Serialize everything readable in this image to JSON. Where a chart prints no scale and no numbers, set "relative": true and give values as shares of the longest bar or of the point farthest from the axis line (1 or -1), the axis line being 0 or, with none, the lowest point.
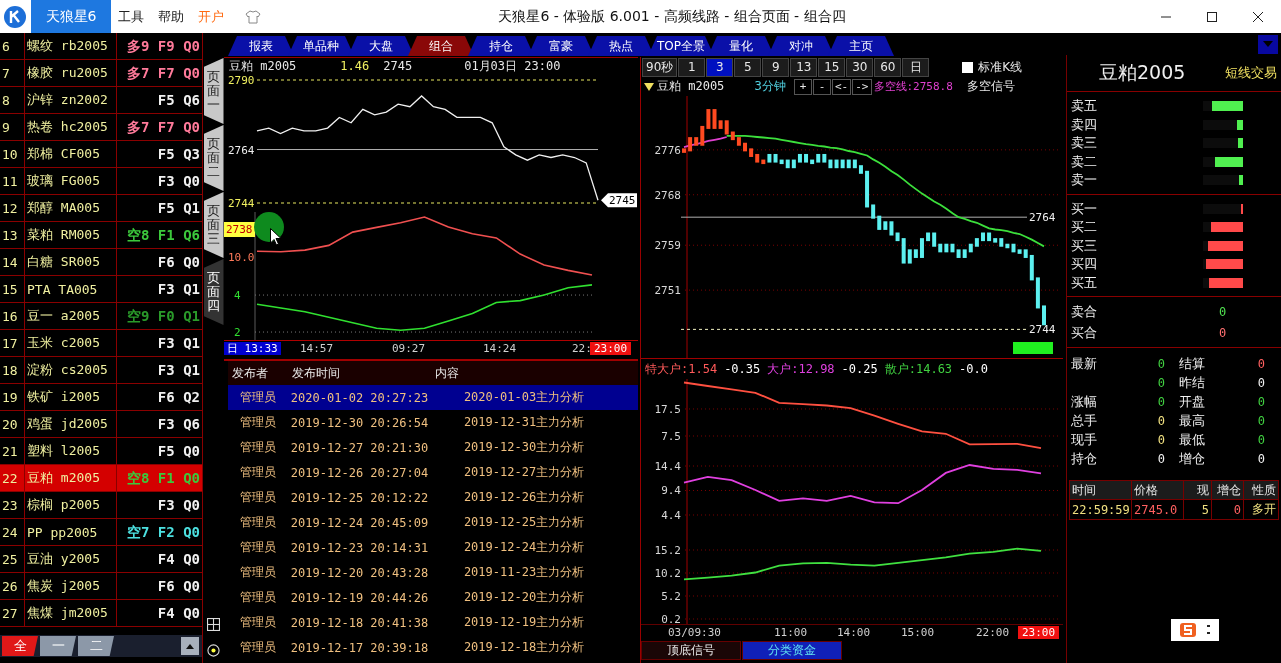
{
  "title_bar": {
    "app_tab": "天狼星6",
    "menu": [
      {
        "label": "工具",
        "kind": "plain"
      },
      {
        "label": "帮助",
        "kind": "plain"
      },
      {
        "label": "开户",
        "kind": "accent"
      }
    ],
    "title": "天狼星6 - 体验版 6.001 - 高频线路 - 组合页面 - 组合四"
  },
  "nav_tabs": [
    {
      "label": "报表",
      "selected": false
    },
    {
      "label": "单品种",
      "selected": false
    },
    {
      "label": "大盘",
      "selected": false
    },
    {
      "label": "组合",
      "selected": true
    },
    {
      "label": "持仓",
      "selected": false
    },
    {
      "label": "富豪",
      "selected": false
    },
    {
      "label": "热点",
      "selected": false
    },
    {
      "label": "TOP全景",
      "selected": false
    },
    {
      "label": "量化",
      "selected": false
    },
    {
      "label": "对冲",
      "selected": false
    },
    {
      "label": "主页",
      "selected": false
    }
  ],
  "watchlist": {
    "rows": [
      {
        "index": "6",
        "name": "螺纹 rb2005",
        "signal": "多9 F9 Q0",
        "color": "#ff7a9a",
        "selected": false
      },
      {
        "index": "7",
        "name": "橡胶 ru2005",
        "signal": "多7 F7 Q0",
        "color": "#ff7a9a",
        "selected": false
      },
      {
        "index": "8",
        "name": "沪锌 zn2002",
        "signal": "F5 Q6",
        "color": "#f0f0f0",
        "selected": false
      },
      {
        "index": "9",
        "name": "热卷 hc2005",
        "signal": "多7 F7 Q0",
        "color": "#ff7a9a",
        "selected": false
      },
      {
        "index": "10",
        "name": "郑棉 CF005",
        "signal": "F5 Q3",
        "color": "#f0f0f0",
        "selected": false
      },
      {
        "index": "11",
        "name": "玻璃 FG005",
        "signal": "F3 Q0",
        "color": "#f0f0f0",
        "selected": false
      },
      {
        "index": "12",
        "name": "郑醇 MA005",
        "signal": "F5 Q1",
        "color": "#f0f0f0",
        "selected": false
      },
      {
        "index": "13",
        "name": "菜粕 RM005",
        "signal": "空8 F1 Q6",
        "color": "#3cc83c",
        "selected": false
      },
      {
        "index": "14",
        "name": "白糖 SR005",
        "signal": "F6 Q0",
        "color": "#f0f0f0",
        "selected": false
      },
      {
        "index": "15",
        "name": "PTA TA005",
        "signal": "F3 Q1",
        "color": "#f0f0f0",
        "selected": false
      },
      {
        "index": "16",
        "name": "豆一 a2005",
        "signal": "空9 F0 Q1",
        "color": "#2a9a2a",
        "selected": false
      },
      {
        "index": "17",
        "name": "玉米 c2005",
        "signal": "F3 Q1",
        "color": "#f0f0f0",
        "selected": false
      },
      {
        "index": "18",
        "name": "淀粉 cs2005",
        "signal": "F3 Q1",
        "color": "#f0f0f0",
        "selected": false
      },
      {
        "index": "19",
        "name": "铁矿 i2005",
        "signal": "F6 Q2",
        "color": "#f0f0f0",
        "selected": false
      },
      {
        "index": "20",
        "name": "鸡蛋 jd2005",
        "signal": "F3 Q6",
        "color": "#f0f0f0",
        "selected": false
      },
      {
        "index": "21",
        "name": "塑料 l2005",
        "signal": "F5 Q0",
        "color": "#f0f0f0",
        "selected": false
      },
      {
        "index": "22",
        "name": "豆粕 m2005",
        "signal": "空8 F1 Q0",
        "color": "#3cc83c",
        "selected": true
      },
      {
        "index": "23",
        "name": "棕榈 p2005",
        "signal": "F3 Q0",
        "color": "#f0f0f0",
        "selected": false
      },
      {
        "index": "24",
        "name": "PP pp2005",
        "signal": "空7 F2 Q0",
        "color": "#4ce0e0",
        "selected": false
      },
      {
        "index": "25",
        "name": "豆油 y2005",
        "signal": "F4 Q0",
        "color": "#f0f0f0",
        "selected": false
      },
      {
        "index": "26",
        "name": "焦炭 j2005",
        "signal": "F6 Q0",
        "color": "#f0f0f0",
        "selected": false
      },
      {
        "index": "27",
        "name": "焦煤 jm2005",
        "signal": "F4 Q0",
        "color": "#f0f0f0",
        "selected": false
      }
    ],
    "tabs": [
      {
        "label": "全",
        "selected": true
      },
      {
        "label": "一",
        "selected": false
      },
      {
        "label": "二",
        "selected": false
      }
    ]
  },
  "page_tabs": [
    {
      "label": "页面一",
      "selected": false
    },
    {
      "label": "页面二",
      "selected": false
    },
    {
      "label": "页面三",
      "selected": false
    },
    {
      "label": "页面四",
      "selected": true
    }
  ],
  "intraday": {
    "instrument": "豆粕 m2005",
    "change": "1.46",
    "price": "2745",
    "datetime": "01月03日 23:00",
    "last_price_tag": "2745",
    "cursor_price": "2738",
    "price_chart": {
      "chart_data": {
        "type": "line",
        "ylim": [
          2744,
          2790
        ],
        "yticks": [
          2790,
          2744
        ],
        "series": [
          {
            "color": "#f0f0f0",
            "values": [
              2771,
              2772,
              2770,
              2772,
              2771,
              2771,
              2772,
              2776,
              2774,
              2779,
              2777,
              2778,
              2781,
              2780,
              2784,
              2780,
              2779,
              2776,
              2776,
              2776,
              2774,
              2765,
              2762,
              2760,
              2762,
              2761,
              2762,
              2761,
              2759,
              2745
            ]
          }
        ],
        "ref_lines": [
          {
            "axis": "y",
            "value": 2764,
            "label": "2764"
          }
        ]
      }
    },
    "indicator_charts": [
      {
        "chart_data": {
          "type": "line",
          "relative": true,
          "series": [
            {
              "color": "#f05050",
              "values": [
                0.41,
                0.4,
                0.43,
                0.51,
                0.74,
                0.82,
                0.9,
                1.0,
                0.83,
                0.71,
                0.64,
                0.36,
                0.17,
                0.08,
                0.0
              ]
            }
          ],
          "annotations": [
            "10.0"
          ]
        }
      },
      {
        "chart_data": {
          "type": "line",
          "ylim": [
            1.57,
            8.49
          ],
          "yticks": [
            4,
            2
          ],
          "grid": true,
          "series": [
            {
              "color": "#30e030",
              "values": [
                3.5,
                3.3,
                3.1,
                2.8,
                2.5,
                2.2,
                2.1,
                2.2,
                2.6,
                3.0,
                3.6,
                3.7,
                4.0,
                4.4,
                4.55
              ]
            }
          ]
        }
      }
    ],
    "time_axis": [
      {
        "text": "日 13:33",
        "kind": "start"
      },
      {
        "text": "14:57",
        "kind": "plain"
      },
      {
        "text": "09:27",
        "kind": "plain"
      },
      {
        "text": "14:24",
        "kind": "plain"
      },
      {
        "text": "22:",
        "kind": "plain"
      },
      {
        "text": "23:00",
        "kind": "end"
      }
    ]
  },
  "news": {
    "columns": [
      "发布者",
      "发布时间",
      "内容"
    ],
    "rows": [
      {
        "publisher": "管理员",
        "time": "2020-01-02 20:27:23",
        "content": "2020-01-03主力分析",
        "selected": true
      },
      {
        "publisher": "管理员",
        "time": "2019-12-30 20:26:54",
        "content": "2019-12-31主力分析",
        "selected": false
      },
      {
        "publisher": "管理员",
        "time": "2019-12-27 20:21:30",
        "content": "2019-12-30主力分析",
        "selected": false
      },
      {
        "publisher": "管理员",
        "time": "2019-12-26 20:27:04",
        "content": "2019-12-27主力分析",
        "selected": false
      },
      {
        "publisher": "管理员",
        "time": "2019-12-25 20:12:22",
        "content": "2019-12-26主力分析",
        "selected": false
      },
      {
        "publisher": "管理员",
        "time": "2019-12-24 20:45:09",
        "content": "2019-12-25主力分析",
        "selected": false
      },
      {
        "publisher": "管理员",
        "time": "2019-12-23 20:14:31",
        "content": "2019-12-24主力分析",
        "selected": false
      },
      {
        "publisher": "管理员",
        "time": "2019-12-20 20:43:28",
        "content": "2019-11-23主力分析",
        "selected": false
      },
      {
        "publisher": "管理员",
        "time": "2019-12-19 20:44:26",
        "content": "2019-12-20主力分析",
        "selected": false
      },
      {
        "publisher": "管理员",
        "time": "2019-12-18 20:41:38",
        "content": "2019-12-19主力分析",
        "selected": false
      },
      {
        "publisher": "管理员",
        "time": "2019-12-17 20:39:18",
        "content": "2019-12-18主力分析",
        "selected": false
      }
    ]
  },
  "kline": {
    "periods": [
      {
        "label": "90秒",
        "selected": false
      },
      {
        "label": "1",
        "selected": false
      },
      {
        "label": "3",
        "selected": true
      },
      {
        "label": "5",
        "selected": false
      },
      {
        "label": "9",
        "selected": false
      },
      {
        "label": "13",
        "selected": false
      },
      {
        "label": "15",
        "selected": false
      },
      {
        "label": "30",
        "selected": false
      },
      {
        "label": "60",
        "selected": false
      },
      {
        "label": "日",
        "selected": false
      }
    ],
    "standard_k": {
      "label": "标准K线",
      "checked": false
    },
    "instrument": "豆粕 m2005",
    "period_label": "3分钟",
    "controls": [
      "+",
      "-",
      "<-",
      "->"
    ],
    "ma_label": "多空线:2758.8",
    "signal_label": "多空信号",
    "chart_data": {
      "type": "line",
      "ylim": [
        2738.9,
        2785.6
      ],
      "yticks": [
        2776,
        2768,
        2759,
        2751
      ],
      "grid": true,
      "series": [
        {
          "color": "#3ce03c",
          "values": [
            null,
            null,
            null,
            null,
            null,
            null,
            null,
            2778.5,
            2778.5,
            2778.5,
            2778.5,
            2778.4,
            2778.3,
            2778.2,
            2778.1,
            2778,
            2777.8,
            2777.6,
            2777.4,
            2777.2,
            2777,
            2776.9,
            2776.7,
            2776.6,
            2776.4,
            2776.3,
            2776.1,
            2775.8,
            2775.6,
            2775.3,
            2775,
            2774.3,
            2773.7,
            2773,
            2772.2,
            2771.5,
            2770.7,
            2769.8,
            2769,
            2768.2,
            2767.5,
            2766.8,
            2766.2,
            2765.5,
            2764.7,
            2764,
            2763.7,
            2763.3,
            2763,
            2762.5,
            2762,
            2761.8,
            2761.7,
            2761.5,
            2761.2,
            2761,
            2760.5,
            2760,
            2759.4,
            2758.8
          ]
        },
        {
          "color": "#e040d0",
          "values": [
            2776.5,
            2776.8,
            2777,
            2777.3,
            2777.6,
            2777.8,
            2778,
            2778.3,
            null,
            null,
            null,
            null,
            null,
            null,
            null,
            null,
            null,
            null,
            null,
            null,
            null,
            null,
            null,
            null,
            null,
            null,
            null,
            null,
            null,
            null,
            null,
            null,
            null,
            null,
            null,
            null,
            null,
            null,
            null,
            null,
            null,
            null,
            null,
            null,
            null,
            null,
            null,
            null,
            null,
            null,
            null,
            null,
            null,
            null,
            null,
            null,
            null,
            null,
            null,
            null
          ]
        }
      ],
      "ref_lines": [
        {
          "axis": "y",
          "value": 2764,
          "label": "2764"
        },
        {
          "axis": "y",
          "value": 2744,
          "label": "2744"
        }
      ]
    },
    "flow_labels": [
      {
        "text": "特大户:1.54",
        "color": "#ff5a5a"
      },
      {
        "text": "-0.35",
        "color": "#ffffff"
      },
      {
        "text": "大户:12.98",
        "color": "#e040e0"
      },
      {
        "text": "-0.25",
        "color": "#ffffff"
      },
      {
        "text": "散户:14.63",
        "color": "#40d040"
      },
      {
        "text": "-0.0",
        "color": "#ffffff"
      }
    ],
    "flow_panels": [
      {
        "chart_data": {
          "type": "line",
          "ylim": [
            0.83,
            28.6
          ],
          "yticks": [
            17.5,
            7.5
          ],
          "grid": true,
          "series": [
            {
              "color": "#ff5040",
              "values": [
                27.3,
                26,
                24.8,
                23.5,
                19.8,
                19.3,
                18.8,
                17.8,
                15,
                12,
                9.2,
                8.3,
                4.4,
                4.5,
                4.6,
                3.0
              ]
            }
          ]
        }
      },
      {
        "chart_data": {
          "type": "line",
          "ylim": [
            2.56,
            16.85
          ],
          "yticks": [
            14.4,
            9.4,
            4.4
          ],
          "grid": true,
          "series": [
            {
              "color": "#e040e0",
              "values": [
                11.0,
                12.2,
                11.5,
                9.5,
                7.3,
                7.8,
                7.3,
                8.3,
                7.0,
                6.8,
                9.5,
                13.0,
                14.6,
                13.8,
                13.6,
                12.9
              ]
            }
          ]
        }
      },
      {
        "chart_data": {
          "type": "line",
          "ylim": [
            -0.89,
            20.85
          ],
          "yticks": [
            15.2,
            10.2,
            5.2,
            0.2
          ],
          "grid": true,
          "series": [
            {
              "color": "#40e040",
              "values": [
                8.8,
                9.2,
                9.6,
                10.3,
                11.8,
                12.3,
                12.4,
                12.0,
                11.8,
                12.4,
                13.0,
                13.6,
                14.4,
                14.8,
                15.5,
                15.0
              ]
            }
          ]
        }
      }
    ],
    "time_axis": [
      {
        "text": "03/09:30",
        "kind": "plain"
      },
      {
        "text": "11:00",
        "kind": "plain"
      },
      {
        "text": "14:00",
        "kind": "plain"
      },
      {
        "text": "15:00",
        "kind": "plain"
      },
      {
        "text": "22:00",
        "kind": "plain"
      },
      {
        "text": "23:00",
        "kind": "end"
      }
    ],
    "bottom_tabs": [
      {
        "label": "顶底信号",
        "selected": false
      },
      {
        "label": "分类资金",
        "selected": true
      }
    ]
  },
  "quote_panel": {
    "title": "豆粕2005",
    "mode": "短线交易",
    "asks": [
      {
        "label": "卖五",
        "level": 0.78
      },
      {
        "label": "卖四",
        "level": 0.15
      },
      {
        "label": "卖三",
        "level": 0.13
      },
      {
        "label": "卖二",
        "level": 0.7
      },
      {
        "label": "卖一",
        "level": 0.1
      }
    ],
    "bids": [
      {
        "label": "买一",
        "level": 0.04
      },
      {
        "label": "买二",
        "level": 0.8
      },
      {
        "label": "买三",
        "level": 0.88
      },
      {
        "label": "买四",
        "level": 0.93
      },
      {
        "label": "买五",
        "level": 0.85
      }
    ],
    "totals": [
      {
        "label": "卖合",
        "value": "0",
        "color": "#50e050"
      },
      {
        "label": "买合",
        "value": "0",
        "color": "#ff7070"
      }
    ],
    "stats": [
      {
        "label": "最新",
        "value": "0",
        "color": "#40d040"
      },
      {
        "label": "结算",
        "value": "0",
        "color": "#ff6060"
      },
      {
        "value": "0",
        "color": "#40d040"
      },
      {
        "label": "昨结",
        "value": "0",
        "color": "#f0f0f0"
      },
      {
        "label": "涨幅",
        "value": "0",
        "color": "#40d040"
      },
      {
        "label": "开盘",
        "value": "0",
        "color": "#40d040"
      },
      {
        "label": "总手",
        "value": "0",
        "color": "#f0e080"
      },
      {
        "label": "最高",
        "value": "0",
        "color": "#40d040"
      },
      {
        "label": "现手",
        "value": "0",
        "color": "#f0e080"
      },
      {
        "label": "最低",
        "value": "0",
        "color": "#40d040"
      },
      {
        "label": "持仓",
        "value": "0",
        "color": "#f0f0f0"
      },
      {
        "label": "增仓",
        "value": "0",
        "color": "#f0f0f0"
      }
    ],
    "trades": {
      "columns": [
        "时间",
        "价格",
        "现",
        "增仓",
        "性质"
      ],
      "rows": [
        [
          {
            "text": "22:59:59",
            "color": "#f0e080"
          },
          {
            "text": "2745.0",
            "color": "#ff6060"
          },
          {
            "text": "5",
            "color": "#f0e080"
          },
          {
            "text": "0",
            "color": "#ff6060"
          },
          {
            "text": "多开",
            "color": "#f0e080"
          }
        ]
      ]
    }
  }
}
